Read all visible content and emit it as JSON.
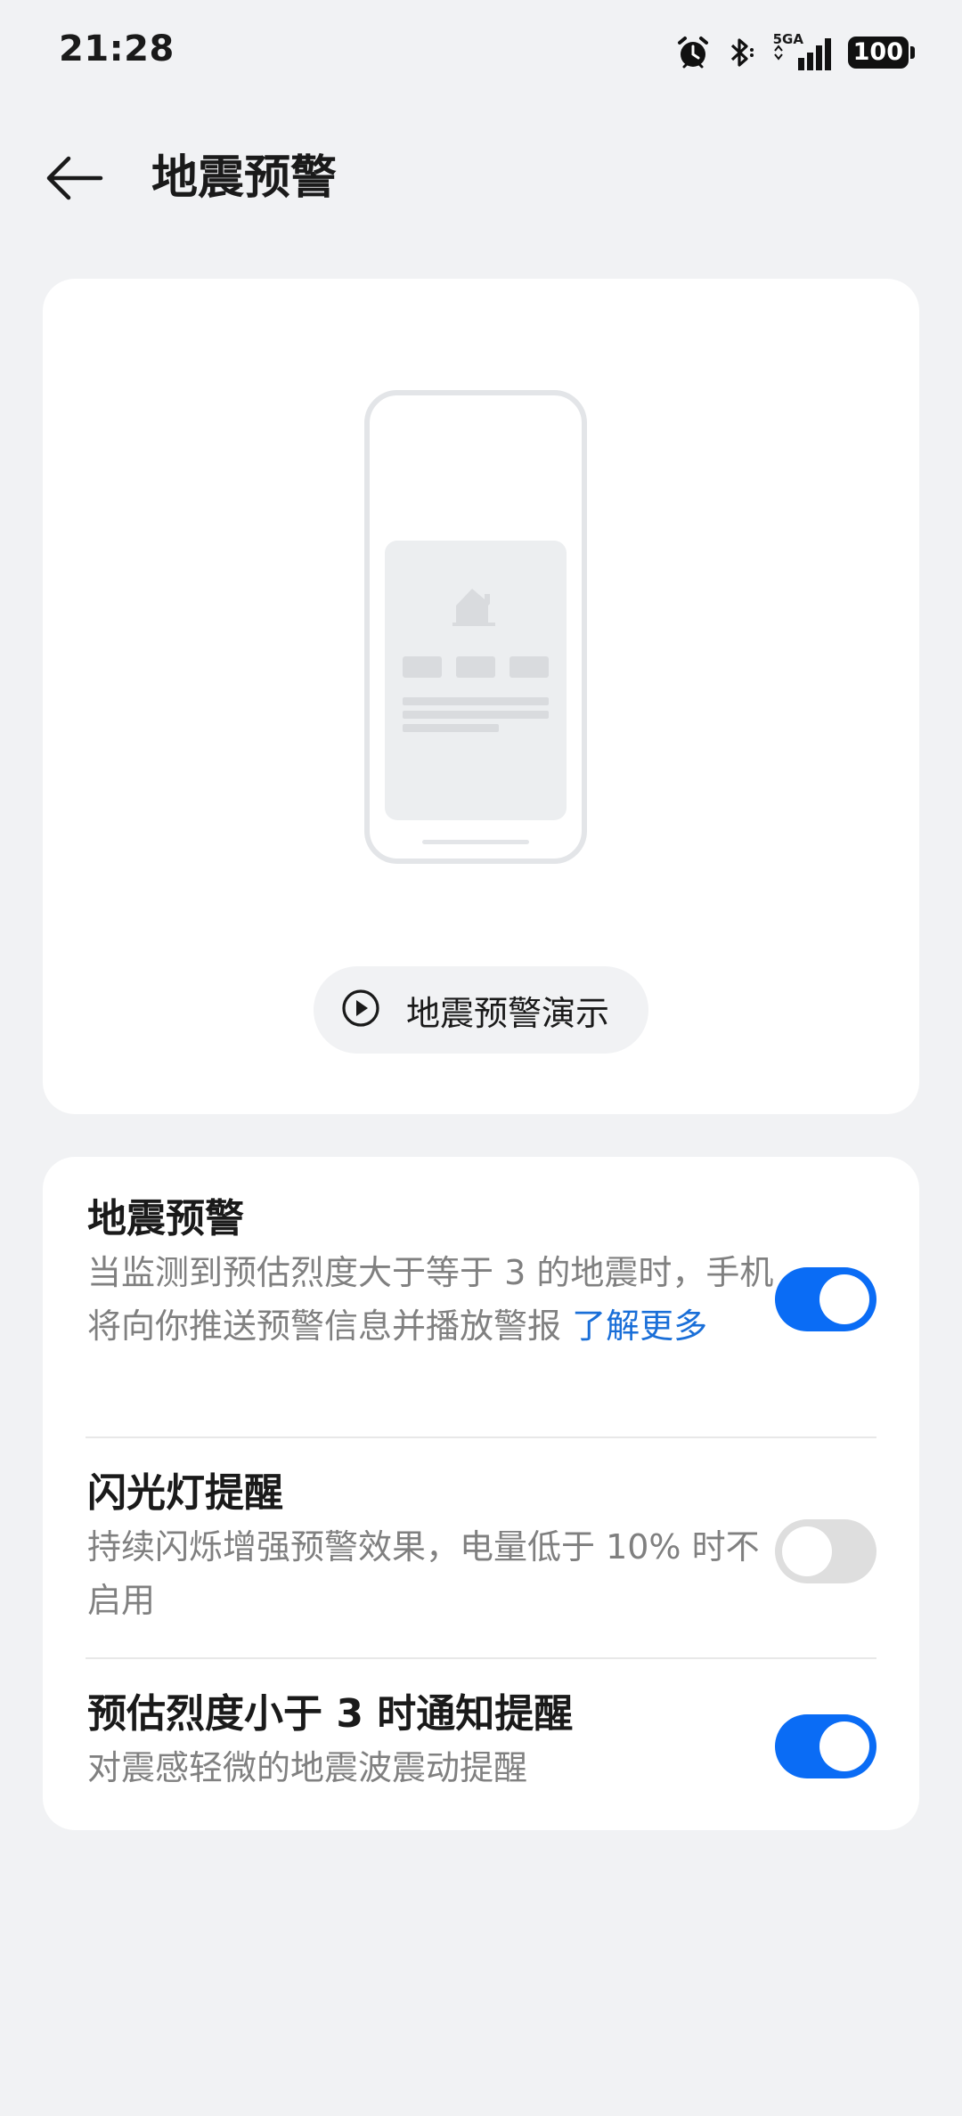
{
  "status_bar": {
    "time": "21:28",
    "network": "5GA",
    "battery": "100",
    "icons": [
      "alarm-icon",
      "bluetooth-icon",
      "signal-icon",
      "battery-icon"
    ]
  },
  "header": {
    "back_icon": "arrow-left-icon",
    "title": "地震预警"
  },
  "hero": {
    "illustration": "phone-alert-illustration",
    "demo_icon": "play-circle-icon",
    "demo_label": "地震预警演示"
  },
  "settings": [
    {
      "title": "地震预警",
      "description": "当监测到预估烈度大于等于 3 的地震时，手机将向你推送预警信息并播放警报",
      "link": "了解更多",
      "enabled": true
    },
    {
      "title": "闪光灯提醒",
      "description": "持续闪烁增强预警效果，电量低于 10% 时不启用",
      "enabled": false
    },
    {
      "title": "预估烈度小于 3 时通知提醒",
      "description": "对震感轻微的地震波震动提醒",
      "enabled": true
    }
  ],
  "colors": {
    "accent": "#0a6cf5",
    "link": "#1a6fd8",
    "background": "#f1f2f4",
    "card": "#ffffff",
    "toggle_off": "#dedede"
  }
}
